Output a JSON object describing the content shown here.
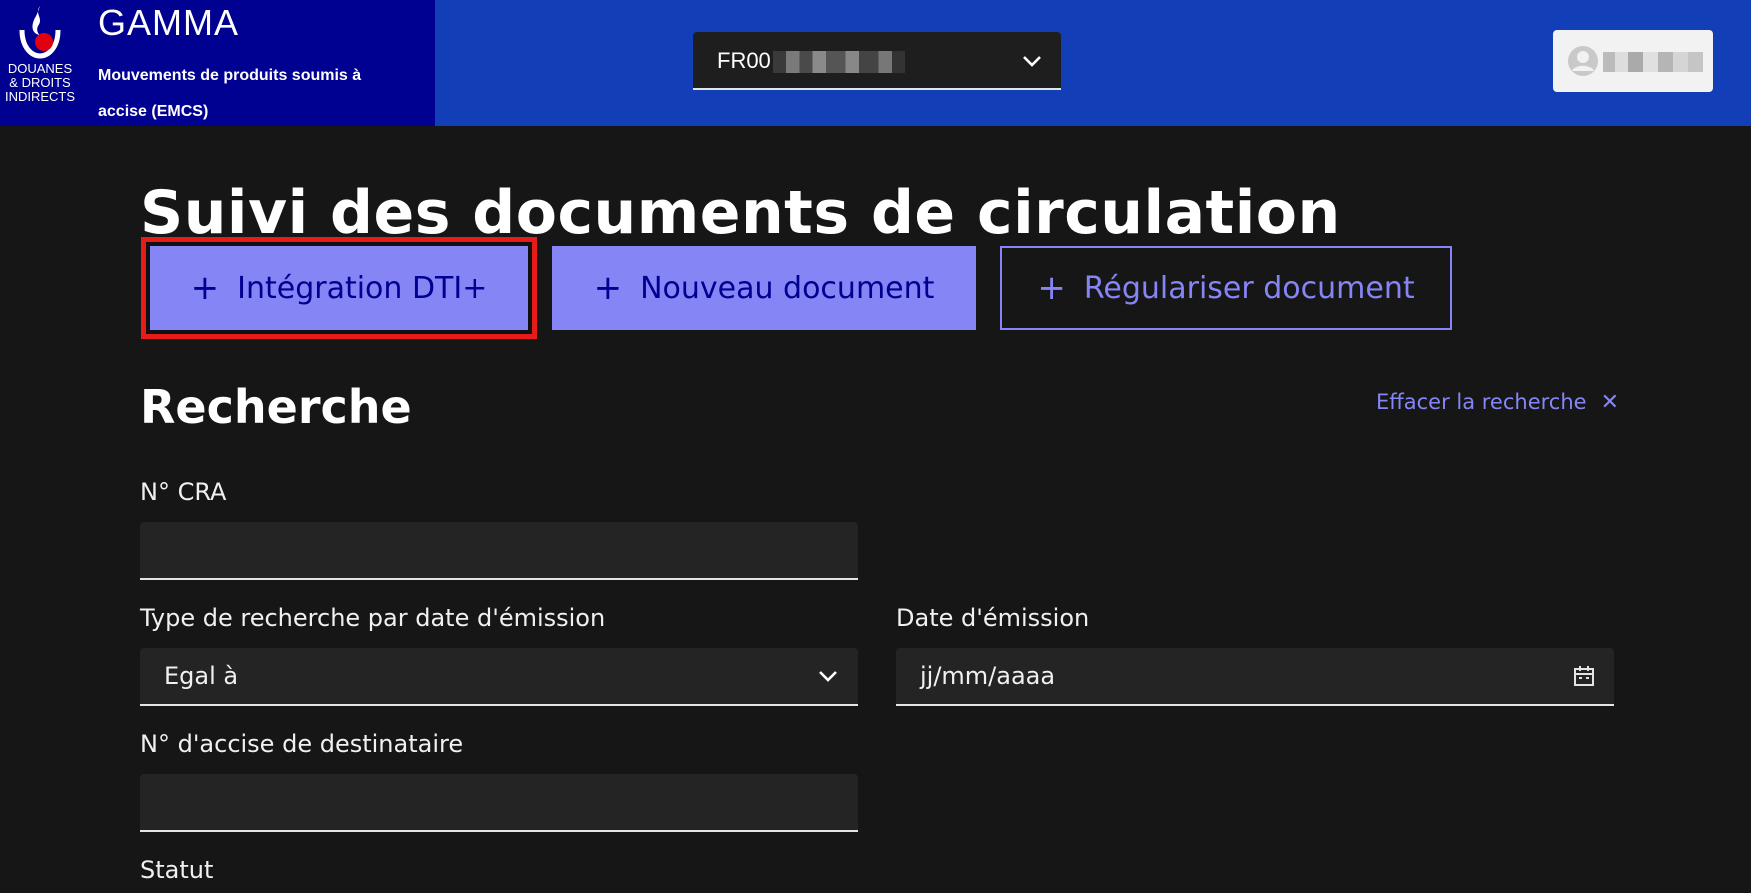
{
  "header": {
    "logo_text": [
      "DOUANES",
      "& DROITS",
      "INDIRECTS"
    ],
    "app_title": "GAMMA",
    "app_subtitle": "Mouvements de produits soumis à accise (EMCS)",
    "entity_select": {
      "value_prefix": "FR00"
    }
  },
  "main": {
    "title": "Suivi des documents de circulation",
    "actions": {
      "integration": "Intégration DTI+",
      "new_document": "Nouveau document",
      "regularize": "Régulariser document"
    },
    "search": {
      "title": "Recherche",
      "clear_label": "Effacer la recherche",
      "fields": {
        "cra_label": "N° CRA",
        "cra_value": "",
        "date_type_label": "Type de recherche par date d'émission",
        "date_type_value": "Egal à",
        "date_label": "Date d'émission",
        "date_placeholder": "jj/mm/aaaa",
        "excise_label": "N° d'accise de destinataire",
        "excise_value": "",
        "status_label": "Statut"
      }
    }
  },
  "colors": {
    "header_blue": "#123fb8",
    "brand_navy": "#000091",
    "accent": "#8585f6",
    "highlight": "#e81b1b"
  }
}
